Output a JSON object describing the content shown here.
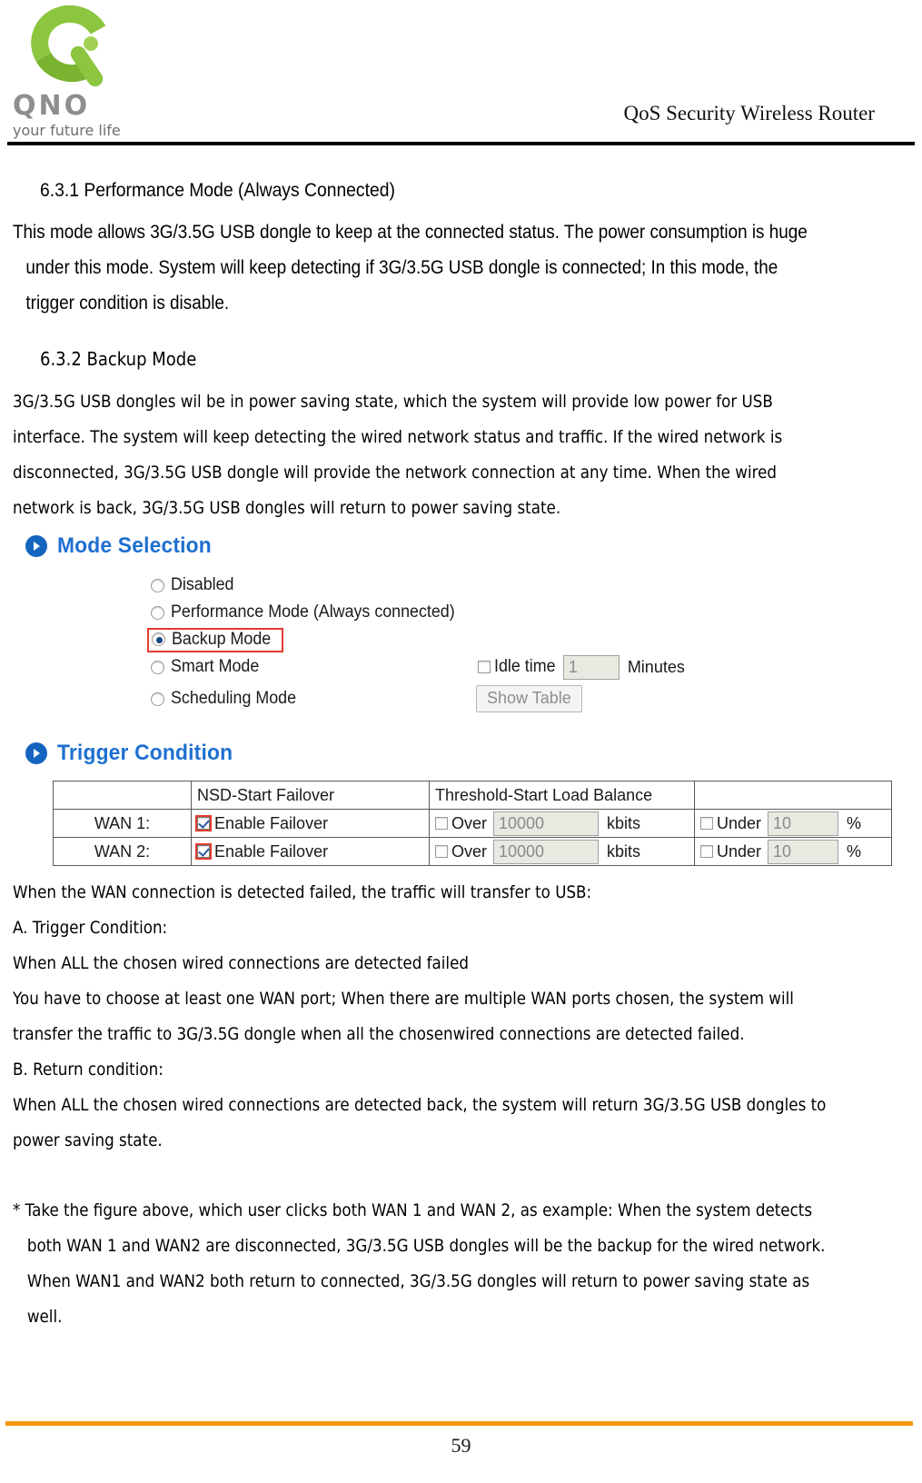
{
  "header": {
    "logo_word": "QNO",
    "logo_tagline": "your future life",
    "title": "QoS Security Wireless Router",
    "logo_icon": "qno-q-logo"
  },
  "sections": {
    "s631_heading": "6.3.1 Performance Mode (Always Connected)",
    "s631_lines": [
      "This mode allows 3G/3.5G USB dongle to keep at the connected status.    The power consumption is huge",
      "under this mode.    System will keep detecting if 3G/3.5G USB dongle is connected; In this mode, the",
      "trigger condition is disable."
    ],
    "s632_heading": "6.3.2 Backup Mode",
    "s632_lines": [
      "3G/3.5G USB dongles wil be in power saving state, which the system will provide low power for USB",
      "interface.    The system will keep detecting the wired network status and traffic.    If the wired network is",
      "disconnected, 3G/3.5G USB dongle will provide the network connection at any time.    When the wired",
      "network is back, 3G/3.5G USB dongles will return to power saving state."
    ]
  },
  "mode_selection": {
    "title": "Mode Selection",
    "options": [
      {
        "label": "Disabled",
        "selected": false,
        "highlighted": false
      },
      {
        "label": "Performance Mode (Always connected)",
        "selected": false,
        "highlighted": false
      },
      {
        "label": "Backup Mode",
        "selected": true,
        "highlighted": true
      },
      {
        "label": "Smart Mode",
        "selected": false,
        "highlighted": false
      },
      {
        "label": "Scheduling Mode",
        "selected": false,
        "highlighted": false
      }
    ],
    "idle_time_label": "Idle time",
    "idle_time_value": "1",
    "idle_time_unit": "Minutes",
    "idle_time_checked": false,
    "show_table_button": "Show Table"
  },
  "trigger_condition": {
    "title": "Trigger Condition",
    "columns": [
      "",
      "NSD-Start Failover",
      "Threshold-Start Load Balance",
      ""
    ],
    "rows": [
      {
        "wan": "WAN 1:",
        "failover_label": "Enable Failover",
        "failover_checked": true,
        "failover_highlighted": true,
        "over_label": "Over",
        "over_value": "10000",
        "over_unit": "kbits",
        "over_checked": false,
        "under_label": "Under",
        "under_value": "10",
        "under_unit": "%",
        "under_checked": false
      },
      {
        "wan": "WAN 2:",
        "failover_label": "Enable Failover",
        "failover_checked": true,
        "failover_highlighted": true,
        "over_label": "Over",
        "over_value": "10000",
        "over_unit": "kbits",
        "over_checked": false,
        "under_label": "Under",
        "under_value": "10",
        "under_unit": "%",
        "under_checked": false
      }
    ]
  },
  "body_text": {
    "lines": [
      "When the WAN connection is detected failed, the traffic will transfer to USB:",
      "A.    Trigger Condition:",
      "When ALL the chosen wired connections are detected failed",
      "You have to choose at least one WAN port; When there are multiple WAN ports chosen, the system will",
      "transfer the traffic to 3G/3.5G dongle when all the chosenwired connections are detected failed.",
      "B. Return condition:",
      "When ALL the chosen wired connections are detected back, the system will return 3G/3.5G USB dongles to",
      "power saving state."
    ],
    "note_lines": [
      "* Take the figure above, which user clicks both WAN 1 and WAN 2, as example: When the system detects",
      "both WAN 1 and WAN2 are disconnected, 3G/3.5G USB dongles will be the backup for the wired network.",
      "When WAN1 and WAN2 both return to connected, 3G/3.5G dongles will return to power saving state as",
      "well."
    ]
  },
  "footer": {
    "page_number": "59",
    "rule_color": "#f5960a"
  }
}
